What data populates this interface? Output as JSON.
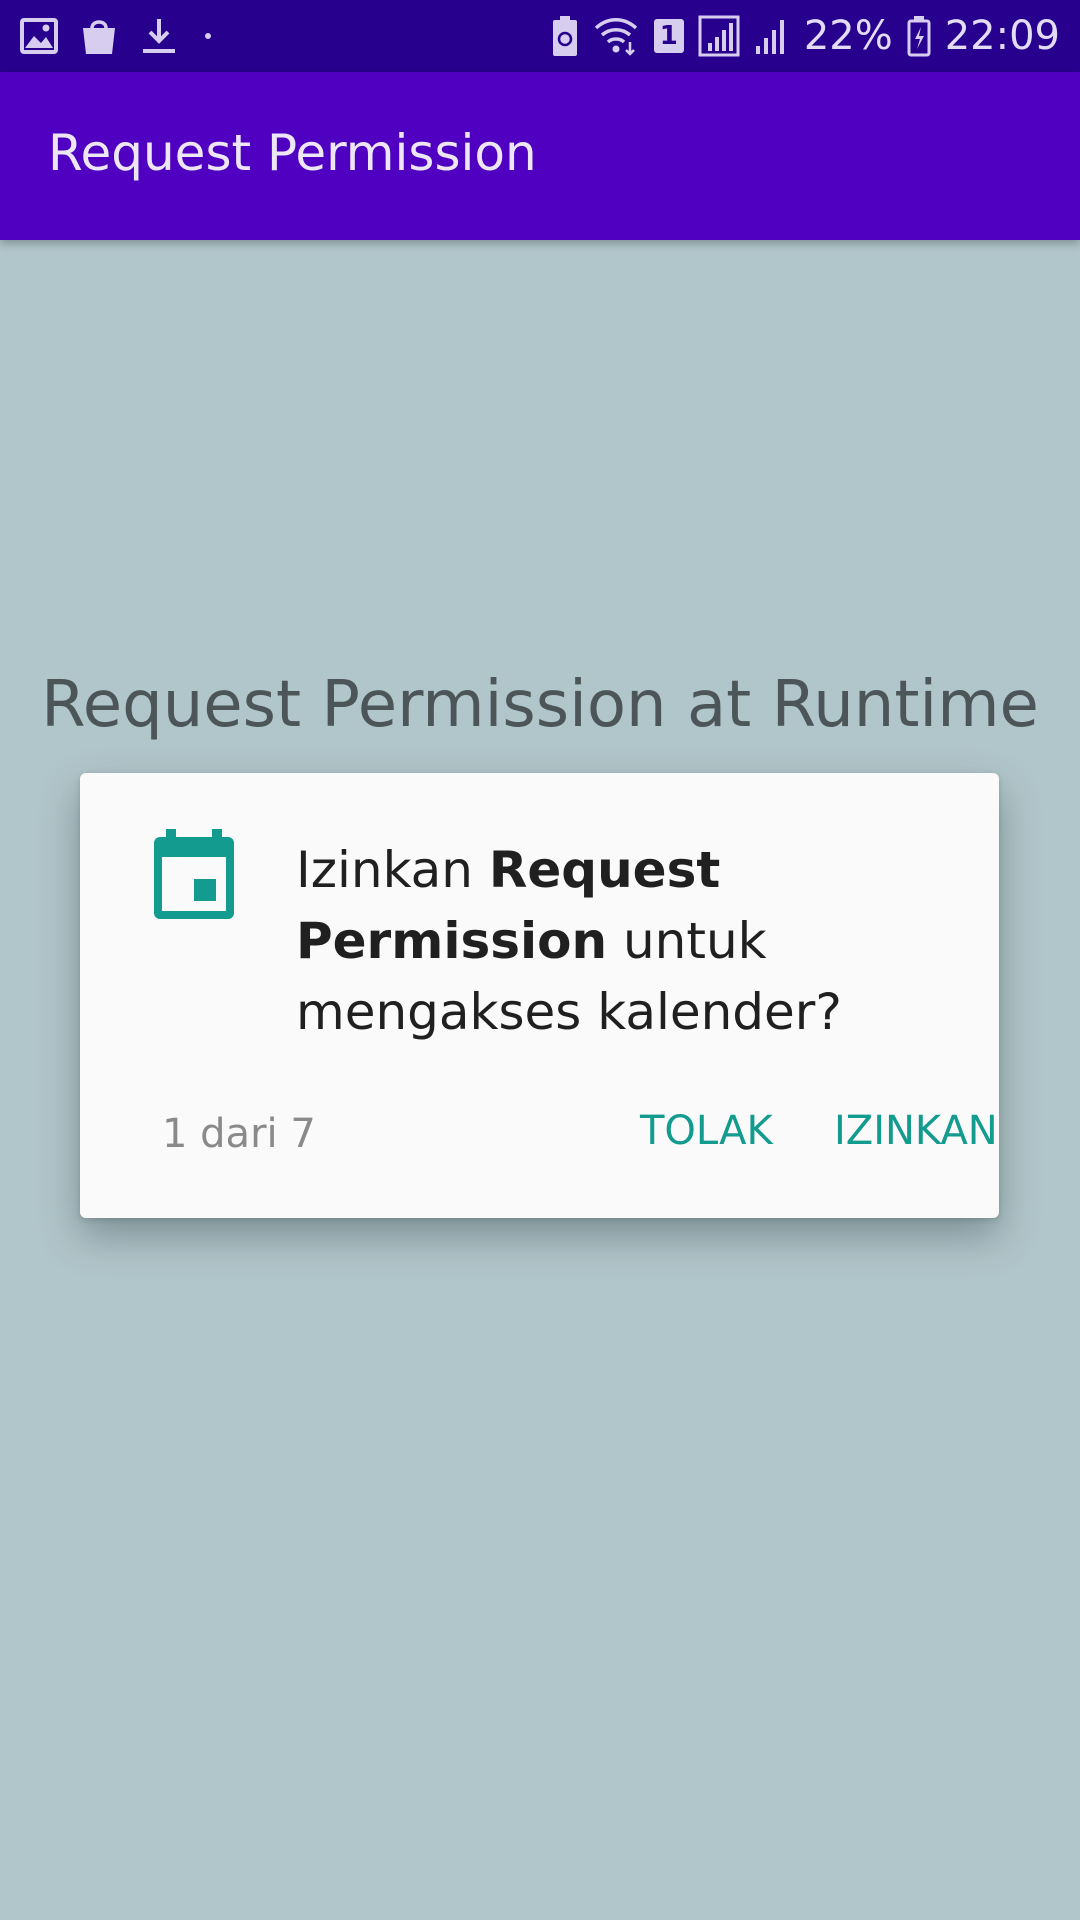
{
  "status_bar": {
    "left_icons": [
      "image-icon",
      "shopping-bag-icon",
      "download-icon",
      "dot-icon"
    ],
    "sim_badge": "1",
    "battery_percent": "22%",
    "time": "22:09"
  },
  "app_bar": {
    "title": "Request Permission"
  },
  "main": {
    "heading": "Request Permission at Runtime"
  },
  "dialog": {
    "icon": "calendar-icon",
    "message_prefix": "Izinkan ",
    "message_app_name": "Request Permission",
    "message_suffix": " untuk mengakses kalender?",
    "counter": "1 dari 7",
    "deny_label": "TOLAK",
    "allow_label": "IZINKAN",
    "accent_color": "#129b8e"
  },
  "colors": {
    "status_bar": "#28008e",
    "app_bar": "#5000c1",
    "background": "#b1c6ca"
  }
}
